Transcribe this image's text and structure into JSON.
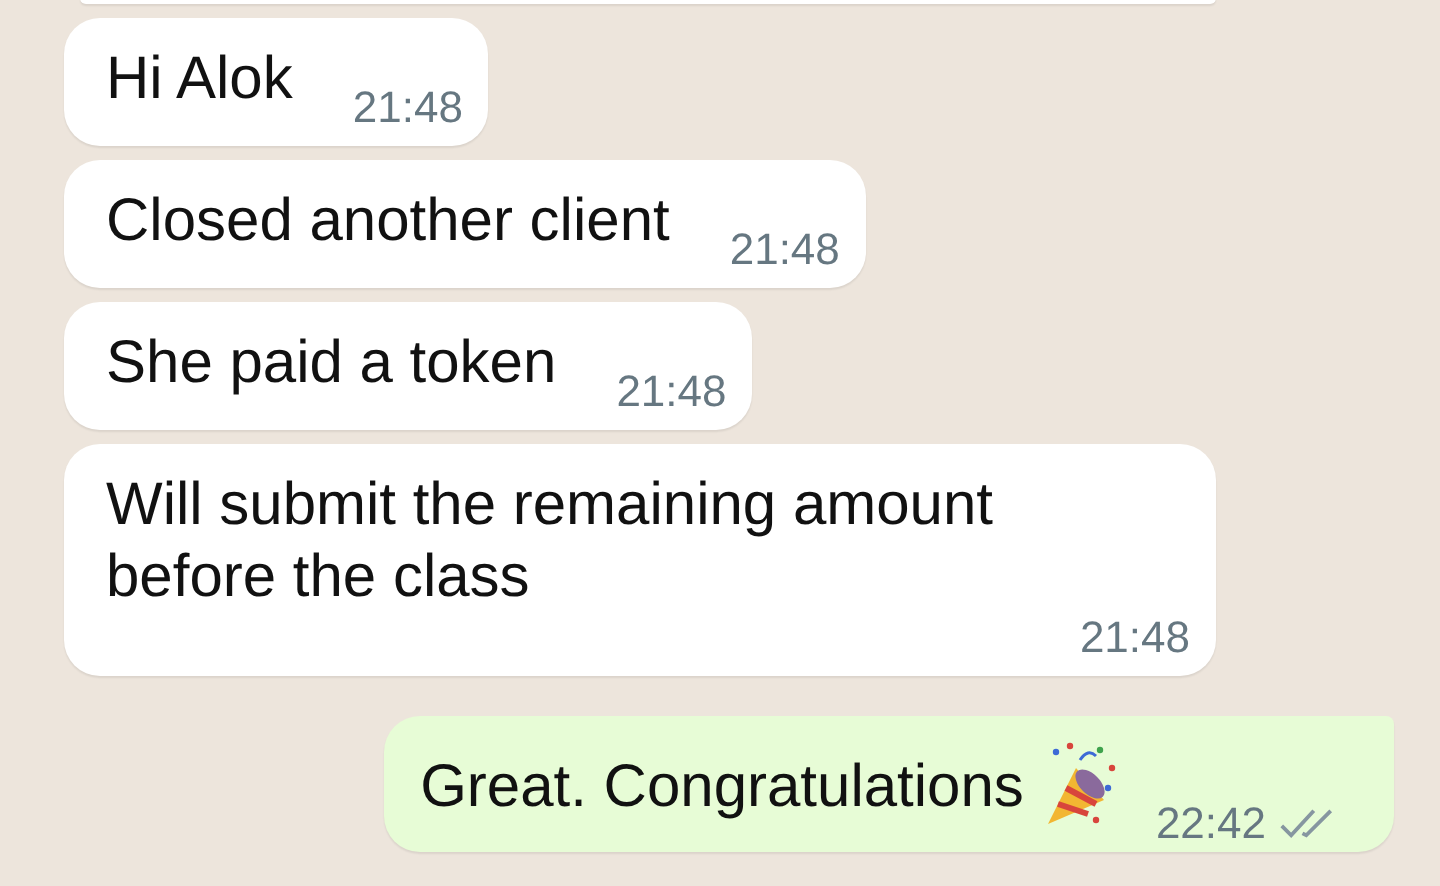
{
  "messages": [
    {
      "kind": "incoming",
      "cut": true
    },
    {
      "kind": "incoming",
      "text": "Hi Alok",
      "time": "21:48"
    },
    {
      "kind": "incoming",
      "text": "Closed another client",
      "time": "21:48"
    },
    {
      "kind": "incoming",
      "text": "She paid a token",
      "time": "21:48"
    },
    {
      "kind": "incoming",
      "text": "Will submit the remaining amount before the class",
      "time": "21:48"
    },
    {
      "kind": "outgoing",
      "text": "Great. Congratulations",
      "party_icon": true,
      "time": "22:42",
      "read": false
    }
  ]
}
